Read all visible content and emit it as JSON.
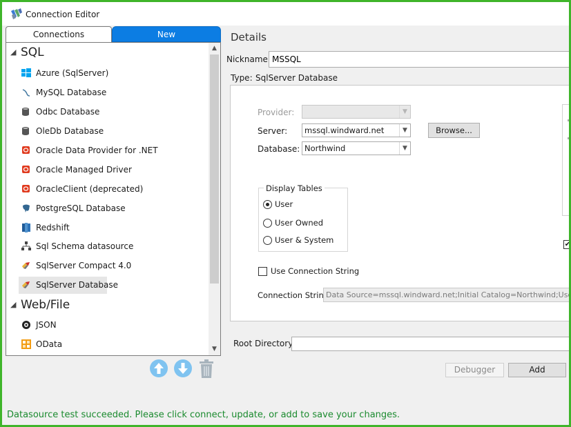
{
  "window": {
    "title": "Connection Editor",
    "border_color": "#3fb52a"
  },
  "tabs": [
    {
      "label": "Connections",
      "active": false
    },
    {
      "label": "New",
      "active": true
    }
  ],
  "tree": {
    "groups": [
      {
        "label": "SQL",
        "expanded": true
      },
      {
        "label": "Web/File",
        "expanded": true
      }
    ],
    "items": [
      {
        "label": "Azure (SqlServer)",
        "icon": "windows-logo-icon"
      },
      {
        "label": "MySQL Database",
        "icon": "mysql-dolphin-icon"
      },
      {
        "label": "Odbc Database",
        "icon": "database-icon"
      },
      {
        "label": "OleDb Database",
        "icon": "database-icon"
      },
      {
        "label": "Oracle Data Provider for .NET",
        "icon": "oracle-icon"
      },
      {
        "label": "Oracle Managed Driver",
        "icon": "oracle-icon"
      },
      {
        "label": "OracleClient (deprecated)",
        "icon": "oracle-icon"
      },
      {
        "label": "PostgreSQL Database",
        "icon": "postgresql-elephant-icon"
      },
      {
        "label": "Redshift",
        "icon": "redshift-icon"
      },
      {
        "label": "Sql Schema datasource",
        "icon": "schema-tree-icon"
      },
      {
        "label": "SqlServer Compact  4.0",
        "icon": "sqlserver-icon"
      },
      {
        "label": "SqlServer Database",
        "icon": "sqlserver-icon",
        "selected": true
      },
      {
        "label": "JSON",
        "icon": "json-icon"
      },
      {
        "label": "OData",
        "icon": "odata-icon"
      }
    ]
  },
  "actions": {
    "move_up": "arrow-up-circle-icon",
    "move_down": "arrow-down-circle-icon",
    "delete": "trash-icon",
    "accent": "#7fc3f0"
  },
  "details": {
    "heading": "Details",
    "nickname_label": "Nickname:",
    "nickname_value": "MSSQL",
    "type_label": "Type:",
    "type_value": "SqlServer Database",
    "provider_label": "Provider:",
    "provider_value": "",
    "server_label": "Server:",
    "server_value": "mssql.windward.net",
    "browse_label": "Browse...",
    "database_label": "Database:",
    "database_value": "Northwind",
    "display_tables": {
      "legend": "Display Tables",
      "options": [
        {
          "label": "User",
          "checked": true
        },
        {
          "label": "User Owned",
          "checked": false
        },
        {
          "label": "User & System",
          "checked": false
        }
      ]
    },
    "use_connection_string_label": "Use Connection String",
    "use_connection_string_checked": false,
    "connection_string_label": "Connection String:",
    "connection_string_value": "Data Source=mssql.windward.net;Initial Catalog=Northwind;User ID=demo",
    "root_directory_label": "Root Directory:",
    "root_directory_value": ""
  },
  "buttons": {
    "debugger": "Debugger",
    "add": "Add"
  },
  "status": {
    "message": "Datasource test succeeded. Please click connect, update, or add to save your changes.",
    "color": "#1a8a2e"
  }
}
